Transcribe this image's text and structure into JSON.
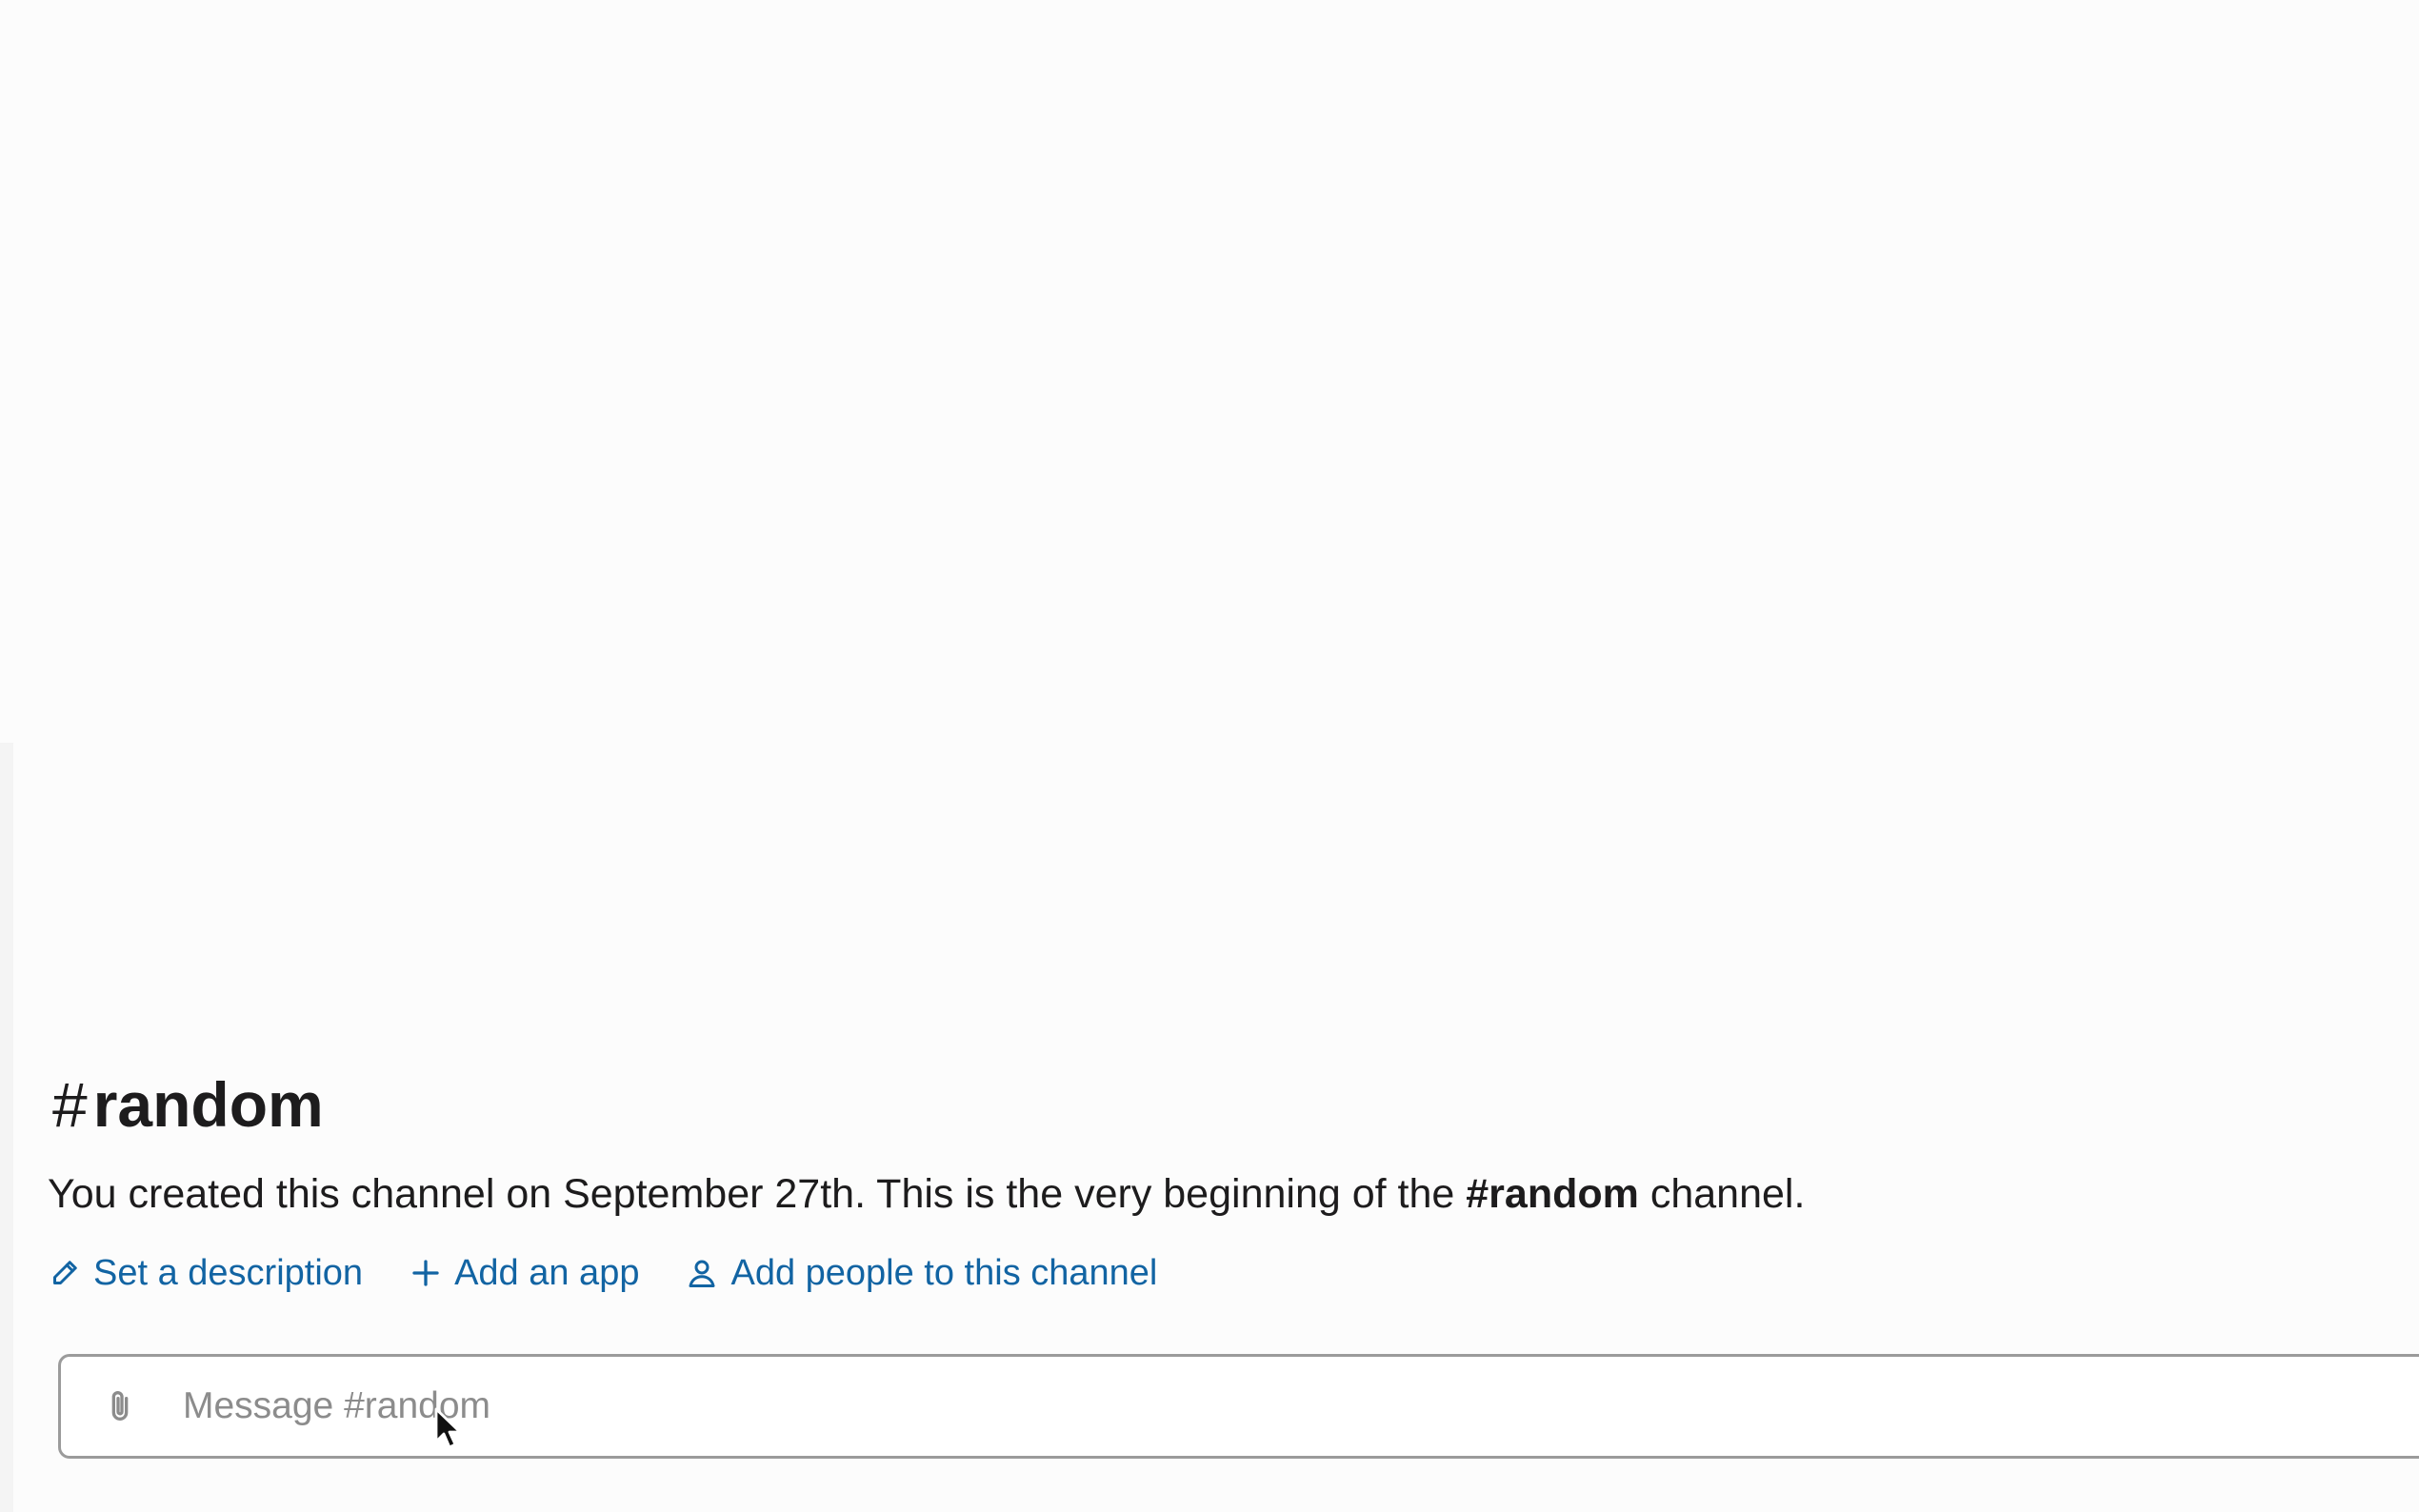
{
  "channel": {
    "hash": "#",
    "name": "random"
  },
  "intro": {
    "before": "You created this channel on September 27th. This is the very beginning of the ",
    "channel_ref": "#random",
    "after": " channel."
  },
  "actions": [
    {
      "label": "Set a description",
      "icon": "pencil-icon"
    },
    {
      "label": "Add an app",
      "icon": "plus-icon"
    },
    {
      "label": "Add people to this channel",
      "icon": "person-icon"
    }
  ],
  "composer": {
    "placeholder": "Message #random",
    "attach_icon": "paperclip-icon"
  },
  "colors": {
    "link": "#1264a3",
    "text": "#1d1c1d",
    "placeholder": "#8c8c8c",
    "border": "#9b9b9b"
  }
}
